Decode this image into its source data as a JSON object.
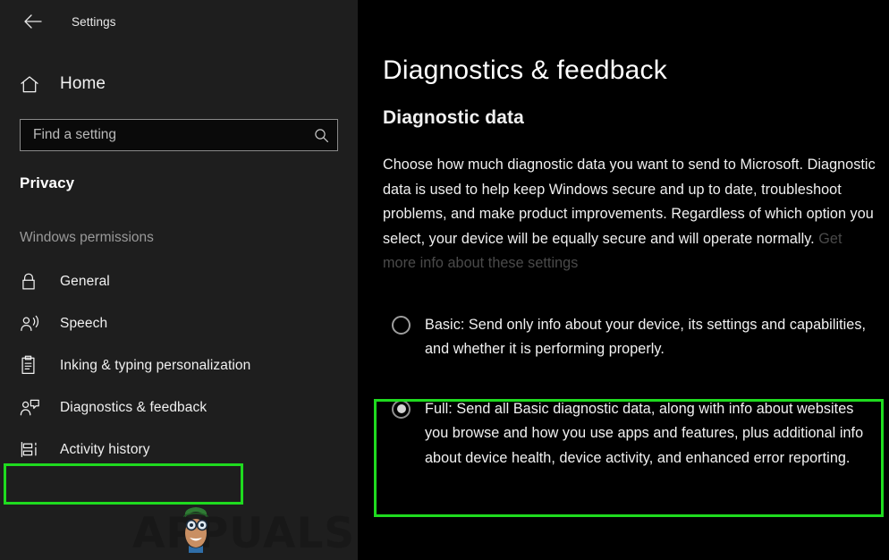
{
  "window": {
    "app_title": "Settings",
    "back_icon": "back-arrow-icon"
  },
  "sidebar": {
    "home": {
      "label": "Home",
      "icon": "home-icon"
    },
    "search": {
      "placeholder": "Find a setting",
      "value": "",
      "icon": "search-icon"
    },
    "category_heading": "Privacy",
    "section_label": "Windows permissions",
    "items": [
      {
        "label": "General",
        "icon": "lock-icon",
        "selected": false
      },
      {
        "label": "Speech",
        "icon": "person-speaking-icon",
        "selected": false
      },
      {
        "label": "Inking & typing personalization",
        "icon": "clipboard-icon",
        "selected": false
      },
      {
        "label": "Diagnostics & feedback",
        "icon": "person-feedback-icon",
        "selected": true
      },
      {
        "label": "Activity history",
        "icon": "timeline-icon",
        "selected": false
      }
    ],
    "watermark": "APPUALS"
  },
  "main": {
    "page_title": "Diagnostics & feedback",
    "section_title": "Diagnostic data",
    "description": "Choose how much diagnostic data you want to send to Microsoft. Diagnostic data is used to help keep Windows secure and up to date, troubleshoot problems, and make product improvements. Regardless of which option you select, your device will be equally secure and will operate normally. ",
    "more_info_link": "Get more info about these settings",
    "options": [
      {
        "id": "basic",
        "label": "Basic: Send only info about your device, its settings and capabilities, and whether it is performing properly.",
        "checked": false
      },
      {
        "id": "full",
        "label": "Full: Send all Basic diagnostic data, along with info about websites you browse and how you use apps and features, plus additional info about device health, device activity, and enhanced error reporting.",
        "checked": true
      }
    ]
  },
  "annotations": {
    "highlight_color": "#1fdb1f",
    "boxes": [
      {
        "target": "sidebar-item-diagnostics-feedback"
      },
      {
        "target": "option-full"
      }
    ]
  }
}
